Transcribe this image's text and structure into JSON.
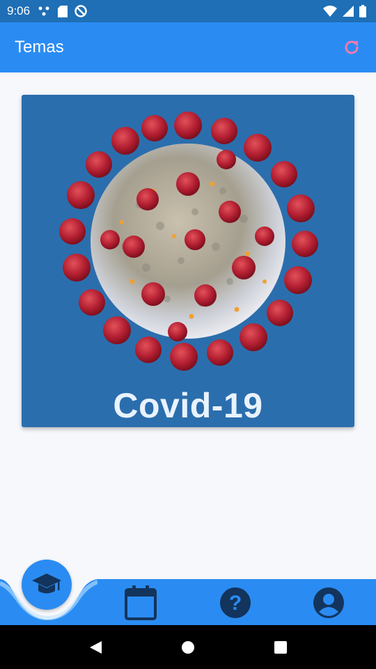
{
  "status": {
    "time": "9:06"
  },
  "appbar": {
    "title": "Temas",
    "refresh_icon": "refresh-icon"
  },
  "topics": [
    {
      "title": "Covid-19",
      "image": "coronavirus-illustration"
    }
  ],
  "bottom_nav": {
    "items": [
      {
        "icon": "graduation-cap-icon",
        "active": true
      },
      {
        "icon": "calendar-icon",
        "active": false
      },
      {
        "icon": "help-icon",
        "active": false
      },
      {
        "icon": "account-icon",
        "active": false
      }
    ]
  },
  "colors": {
    "primary": "#2a8cf2",
    "status_bar": "#1f6fb6",
    "card": "#2b6ead",
    "icon_dark": "#13345c",
    "refresh_accent": "#f07ab0"
  }
}
